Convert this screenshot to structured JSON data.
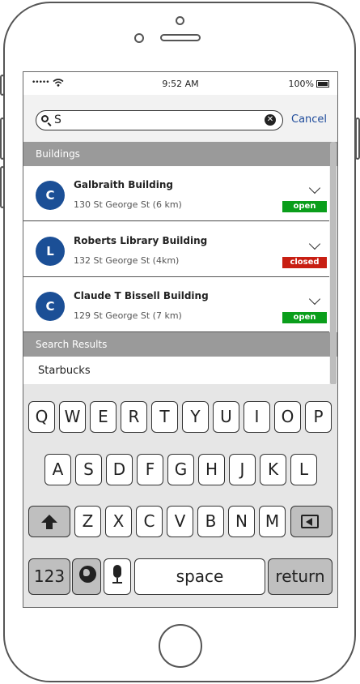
{
  "status_bar": {
    "signal": "•••••",
    "time": "9:52 AM",
    "battery_percent": "100%"
  },
  "search": {
    "query": "S",
    "clear_icon": "clear-circle-icon",
    "cancel_label": "Cancel"
  },
  "sections": {
    "buildings_header": "Buildings",
    "results_header": "Search Results"
  },
  "buildings": [
    {
      "initial": "C",
      "name": "Galbraith Building",
      "address": "130 St George St (6 km)",
      "status": "open"
    },
    {
      "initial": "L",
      "name": "Roberts Library Building",
      "address": "132 St George St (4km)",
      "status": "closed"
    },
    {
      "initial": "C",
      "name": "Claude T Bissell Building",
      "address": "129 St George St (7 km)",
      "status": "open"
    }
  ],
  "results": [
    {
      "label": "Starbucks"
    }
  ],
  "keyboard": {
    "row1": [
      "Q",
      "W",
      "E",
      "R",
      "T",
      "Y",
      "U",
      "I",
      "O",
      "P"
    ],
    "row2": [
      "A",
      "S",
      "D",
      "F",
      "G",
      "H",
      "J",
      "K",
      "L"
    ],
    "row3": [
      "Z",
      "X",
      "C",
      "V",
      "B",
      "N",
      "M"
    ],
    "numbers_key": "123",
    "space_key": "space",
    "return_key": "return"
  },
  "colors": {
    "avatar": "#1b4f96",
    "open": "#0a9e1b",
    "closed": "#c81e12",
    "link": "#1e4b9b",
    "section": "#9a9a9a"
  }
}
